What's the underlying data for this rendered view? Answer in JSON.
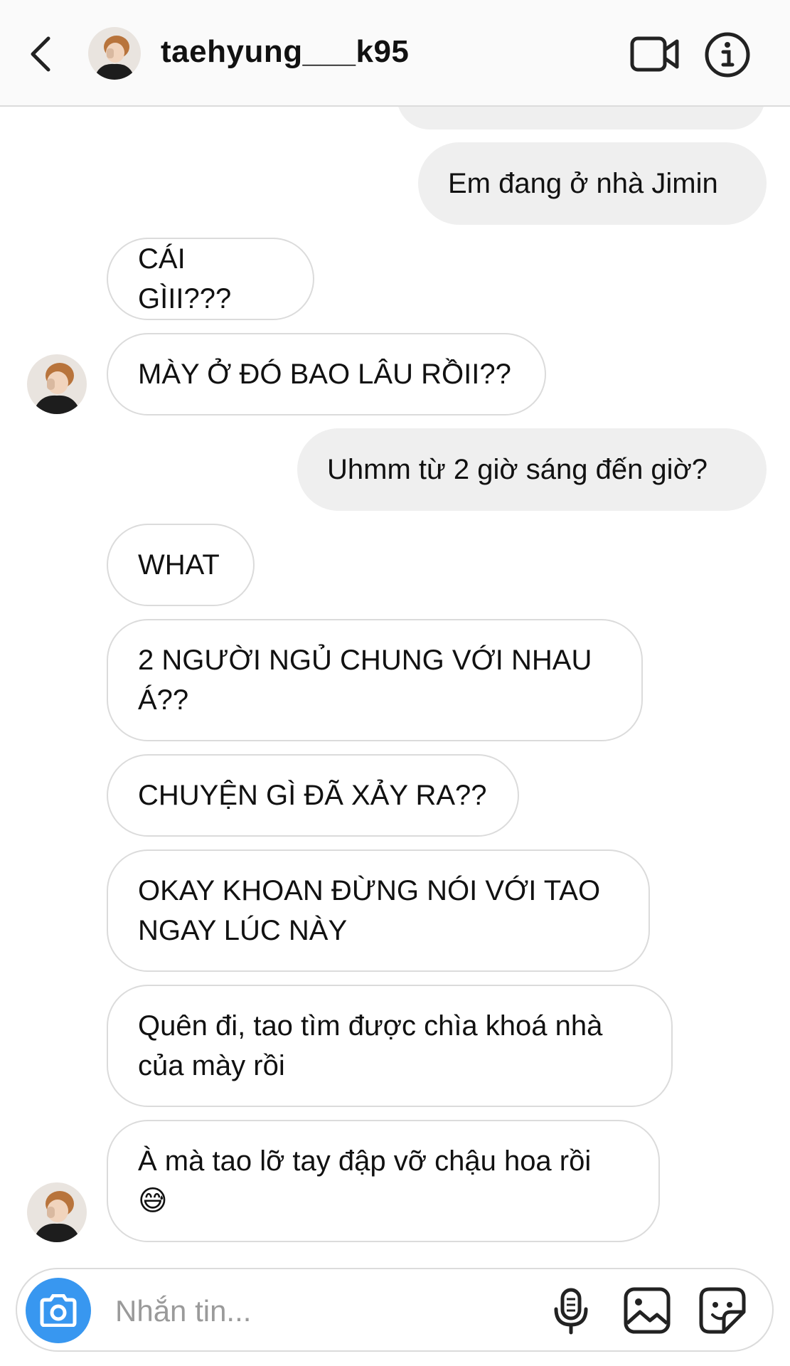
{
  "header": {
    "username": "taehyung___k95",
    "back_icon": "chevron-left-icon",
    "video_icon": "video-camera-icon",
    "info_icon": "info-icon"
  },
  "messages": [
    {
      "from": "me",
      "text": ""
    },
    {
      "from": "me",
      "text": "Em đang ở nhà Jimin"
    },
    {
      "from": "them",
      "text": "CÁI GÌII???"
    },
    {
      "from": "them",
      "text": "MÀY Ở ĐÓ BAO LÂU RỒII??"
    },
    {
      "from": "me",
      "text": "Uhmm từ 2 giờ sáng đến giờ?"
    },
    {
      "from": "them",
      "text": "WHAT"
    },
    {
      "from": "them",
      "text": "2 NGƯỜI NGỦ CHUNG VỚI NHAU Á??"
    },
    {
      "from": "them",
      "text": "CHUYỆN GÌ ĐÃ XẢY RA??"
    },
    {
      "from": "them",
      "text": "OKAY KHOAN ĐỪNG NÓI VỚI TAO NGAY LÚC NÀY"
    },
    {
      "from": "them",
      "text": "Quên đi, tao tìm được chìa khoá nhà của mày rồi"
    },
    {
      "from": "them",
      "text": "À mà tao lỡ tay đập vỡ chậu hoa rồi\n😅"
    }
  ],
  "composer": {
    "placeholder": "Nhắn tin...",
    "camera_icon": "camera-icon",
    "mic_icon": "microphone-icon",
    "photo_icon": "image-icon",
    "sticker_icon": "sticker-icon"
  },
  "colors": {
    "accent": "#3897f0",
    "outgoing_bubble": "#efefef",
    "incoming_border": "#dbdbdb"
  }
}
